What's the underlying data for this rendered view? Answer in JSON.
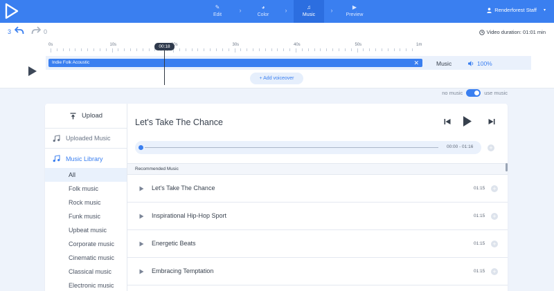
{
  "colors": {
    "accent": "#3a7ff0",
    "topbar": "#3a7ff0",
    "active_step": "#2c6ee0",
    "text": "#37404d"
  },
  "nav": {
    "steps": [
      {
        "label": "Edit",
        "icon": "pencil-icon"
      },
      {
        "label": "Color",
        "icon": "palette-icon"
      },
      {
        "label": "Music",
        "icon": "music-note-icon"
      },
      {
        "label": "Preview",
        "icon": "play-icon"
      }
    ],
    "active_step": "Music",
    "user_name": "Renderforest Staff"
  },
  "history": {
    "undo_count": "3",
    "redo_count": "0"
  },
  "video_duration": "Video duration: 01:01 min",
  "ruler_ticks": [
    "0s",
    "10s",
    "20s",
    "30s",
    "40s",
    "50s",
    "1m"
  ],
  "playhead_time": "00:18",
  "track": {
    "name": "Indie Folk Acoustic",
    "type_label": "Music",
    "volume": "100%"
  },
  "add_voiceover": "Add voiceover",
  "music_toggle": {
    "off_label": "no music",
    "on_label": "use music",
    "enabled": true
  },
  "sidebar": {
    "upload": "Upload",
    "uploaded_music": "Uploaded Music",
    "music_library": "Music Library",
    "categories": [
      "All",
      "Folk music",
      "Rock music",
      "Funk music",
      "Upbeat music",
      "Corporate music",
      "Cinematic music",
      "Classical music",
      "Electronic music"
    ],
    "selected_category": "All"
  },
  "player": {
    "title": "Let's Take The Chance",
    "time": "00:00 - 01:16"
  },
  "recommended_header": "Recommended Music",
  "songs": [
    {
      "name": "Let's Take The Chance",
      "duration": "01:15"
    },
    {
      "name": "Inspirational Hip-Hop Sport",
      "duration": "01:15"
    },
    {
      "name": "Energetic Beats",
      "duration": "01:15"
    },
    {
      "name": "Embracing Temptation",
      "duration": "01:15"
    }
  ]
}
